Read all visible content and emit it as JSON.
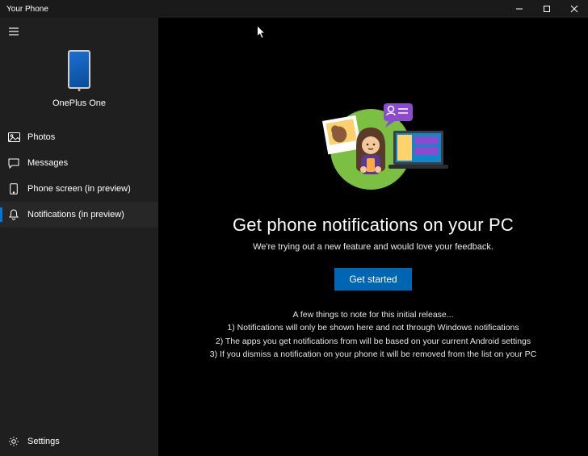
{
  "window": {
    "title": "Your Phone"
  },
  "device": {
    "name": "OnePlus One"
  },
  "nav": {
    "items": [
      {
        "label": "Photos"
      },
      {
        "label": "Messages"
      },
      {
        "label": "Phone screen (in preview)"
      },
      {
        "label": "Notifications (in preview)"
      }
    ],
    "settings_label": "Settings"
  },
  "main": {
    "headline": "Get phone notifications on your PC",
    "subtext": "We're trying out a new feature and would love your feedback.",
    "cta_label": "Get started",
    "notes": {
      "intro": "A few things to note for this initial release...",
      "n1": "1) Notifications will only be shown here and not through Windows notifications",
      "n2": "2) The apps you get notifications from will be based on your current Android settings",
      "n3": "3) If you dismiss a notification on your phone it will be removed from the list on your PC"
    }
  },
  "colors": {
    "accent": "#0078d4"
  }
}
